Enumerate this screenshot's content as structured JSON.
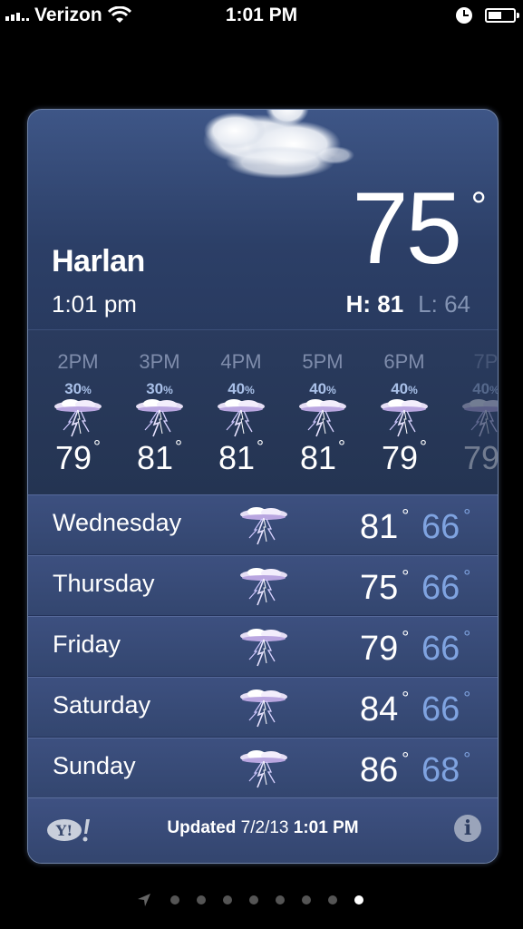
{
  "status_bar": {
    "carrier": "Verizon",
    "time": "1:01 PM",
    "battery_level": 0.55
  },
  "weather": {
    "city": "Harlan",
    "local_time": "1:01 pm",
    "current_temp": "75",
    "degree_symbol": "°",
    "high_label": "H: 81",
    "low_label": "L: 64"
  },
  "hourly": [
    {
      "time": "2PM",
      "precip": "30",
      "temp": "79"
    },
    {
      "time": "3PM",
      "precip": "30",
      "temp": "81"
    },
    {
      "time": "4PM",
      "precip": "40",
      "temp": "81"
    },
    {
      "time": "5PM",
      "precip": "40",
      "temp": "81"
    },
    {
      "time": "6PM",
      "precip": "40",
      "temp": "79"
    },
    {
      "time": "7P",
      "precip": "40",
      "temp": "79"
    }
  ],
  "percent_sign": "%",
  "daily": [
    {
      "day": "Wednesday",
      "high": "81",
      "low": "66"
    },
    {
      "day": "Thursday",
      "high": "75",
      "low": "66"
    },
    {
      "day": "Friday",
      "high": "79",
      "low": "66"
    },
    {
      "day": "Saturday",
      "high": "84",
      "low": "66"
    },
    {
      "day": "Sunday",
      "high": "86",
      "low": "68"
    }
  ],
  "footer": {
    "updated_label": "Updated",
    "updated_date": "7/2/13",
    "updated_time": "1:01 PM",
    "yahoo_logo": "Y!",
    "info_icon": "i"
  },
  "pager": {
    "total_pages": 9,
    "active_page": 9
  },
  "icons": {
    "condition": "thunderstorm-icon",
    "wifi": "wifi-icon",
    "alarm": "clock-icon",
    "location": "location-arrow-icon"
  },
  "colors": {
    "low_temp": "#7fa3e0",
    "card_top": "#3e5687",
    "card_bottom": "#2c3f64"
  }
}
